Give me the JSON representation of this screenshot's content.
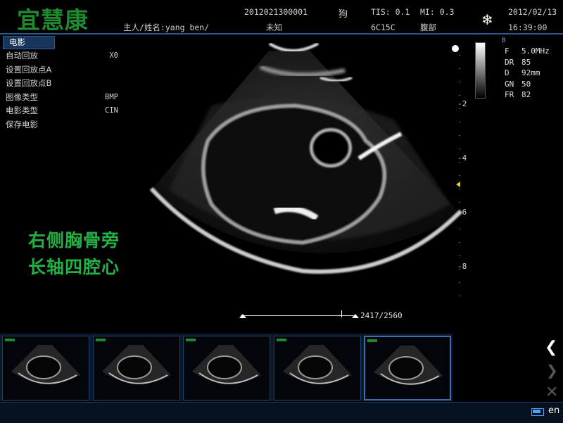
{
  "header": {
    "logo_text": "宜慧康",
    "patient_label": "主人/姓名:yang ben/",
    "exam_id": "2012021300001",
    "species": "狗",
    "unknown_label": "未知",
    "tis": "TIS: 0.1",
    "mi": "MI: 0.3",
    "probe": "6C15C",
    "region": "腹部",
    "date": "2012/02/13",
    "time": "16:39:00",
    "freeze_icon": "snowflake-icon"
  },
  "menu": {
    "tab_label": "电影",
    "items": [
      {
        "label": "自动回放",
        "value": "X0"
      },
      {
        "label": "设置回放点A",
        "value": ""
      },
      {
        "label": "设置回放点B",
        "value": ""
      },
      {
        "label": "图像类型",
        "value": "BMP"
      },
      {
        "label": "电影类型",
        "value": "CIN"
      },
      {
        "label": "保存电影",
        "value": ""
      }
    ]
  },
  "annotation": {
    "line1": "右侧胸骨旁",
    "line2": "长轴四腔心"
  },
  "params": {
    "mode": "B",
    "rows": [
      {
        "key": "F",
        "value": "5.0MHz"
      },
      {
        "key": "DR",
        "value": "85"
      },
      {
        "key": "D",
        "value": "92mm"
      },
      {
        "key": "GN",
        "value": "50"
      },
      {
        "key": "FR",
        "value": "82"
      }
    ]
  },
  "depth_scale": [
    "-2",
    "-4",
    "-6",
    "-8"
  ],
  "cine": {
    "frame_counter": "2417/2560",
    "progress": 0.944
  },
  "thumbnails": {
    "count": 5,
    "selected_index": 4
  },
  "bottom": {
    "language": "en",
    "nav_icons": [
      "chevron-left-icon",
      "chevron-right-icon",
      "close-icon"
    ]
  }
}
